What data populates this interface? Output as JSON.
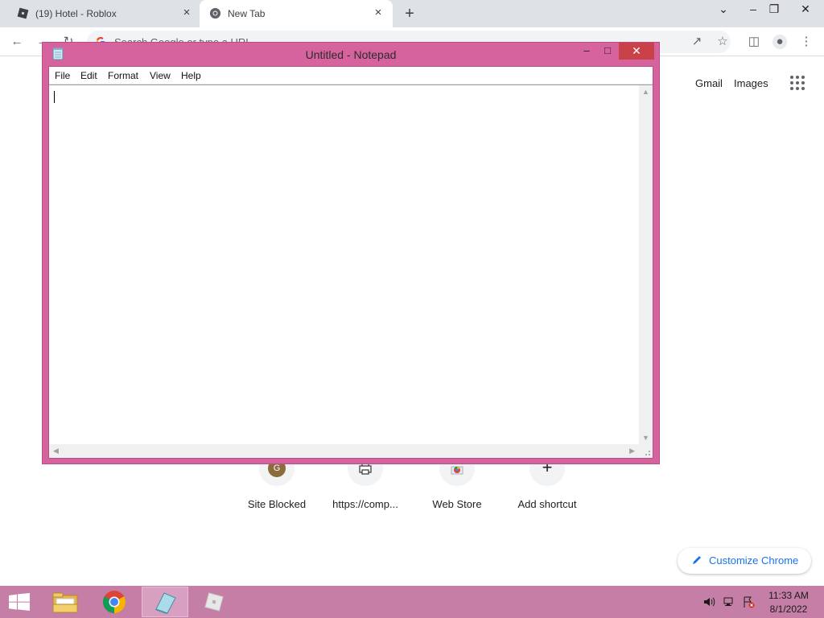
{
  "browser": {
    "tabs": [
      {
        "title": "(19) Hotel - Roblox",
        "icon": "roblox-icon"
      },
      {
        "title": "New Tab",
        "icon": "chrome-icon"
      }
    ],
    "new_tab_symbol": "+",
    "close_symbol": "×",
    "omnibox_placeholder": "Search Google or type a URL",
    "window_controls": {
      "chevron": "⌄",
      "minimize": "–",
      "restore": "❐",
      "close": "✕"
    }
  },
  "ntp": {
    "top_links": [
      "Gmail",
      "Images"
    ],
    "shortcuts": [
      {
        "label": "Site Blocked",
        "letter": "G",
        "icon": "letter-g-icon"
      },
      {
        "label": "https://comp...",
        "icon": "printer-icon"
      },
      {
        "label": "Web Store",
        "icon": "chrome-web-store-icon"
      },
      {
        "label": "Add shortcut",
        "symbol": "+",
        "icon": "plus-icon"
      }
    ],
    "customize_label": "Customize Chrome"
  },
  "notepad": {
    "title": "Untitled - Notepad",
    "menu": [
      "File",
      "Edit",
      "Format",
      "View",
      "Help"
    ],
    "content": "",
    "controls": {
      "minimize": "–",
      "maximize": "□",
      "close": "✕"
    },
    "frame_color": "#d6639e",
    "close_color": "#c94149"
  },
  "taskbar": {
    "time": "11:33 AM",
    "date": "8/1/2022",
    "apps": [
      "file-explorer-icon",
      "chrome-icon",
      "notepad-icon",
      "roblox-icon"
    ],
    "active_app": "notepad-icon",
    "tray": [
      "speaker-icon",
      "network-icon",
      "action-center-icon"
    ],
    "color": "#c57fa6"
  }
}
